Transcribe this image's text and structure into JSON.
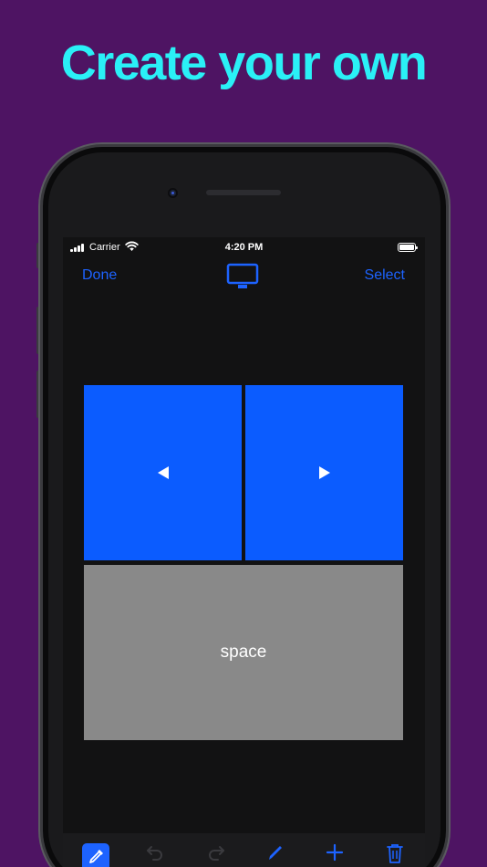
{
  "headline": "Create your own",
  "status_bar": {
    "carrier": "Carrier",
    "time": "4:20 PM"
  },
  "nav": {
    "done_label": "Done",
    "select_label": "Select",
    "center_icon": "tv-icon"
  },
  "pads": [
    {
      "type": "button",
      "icon": "triangle-left-icon",
      "color": "#0b5cff"
    },
    {
      "type": "button",
      "icon": "triangle-right-icon",
      "color": "#0b5cff"
    },
    {
      "type": "button",
      "label": "space",
      "color": "#898989"
    }
  ],
  "toolbar": {
    "tools": [
      "color-picker-icon",
      "undo-icon",
      "redo-icon",
      "pencil-icon",
      "plus-icon",
      "trash-icon"
    ]
  },
  "colors": {
    "background": "#4e1463",
    "headline": "#2af0f6",
    "accent": "#1d63ff"
  }
}
